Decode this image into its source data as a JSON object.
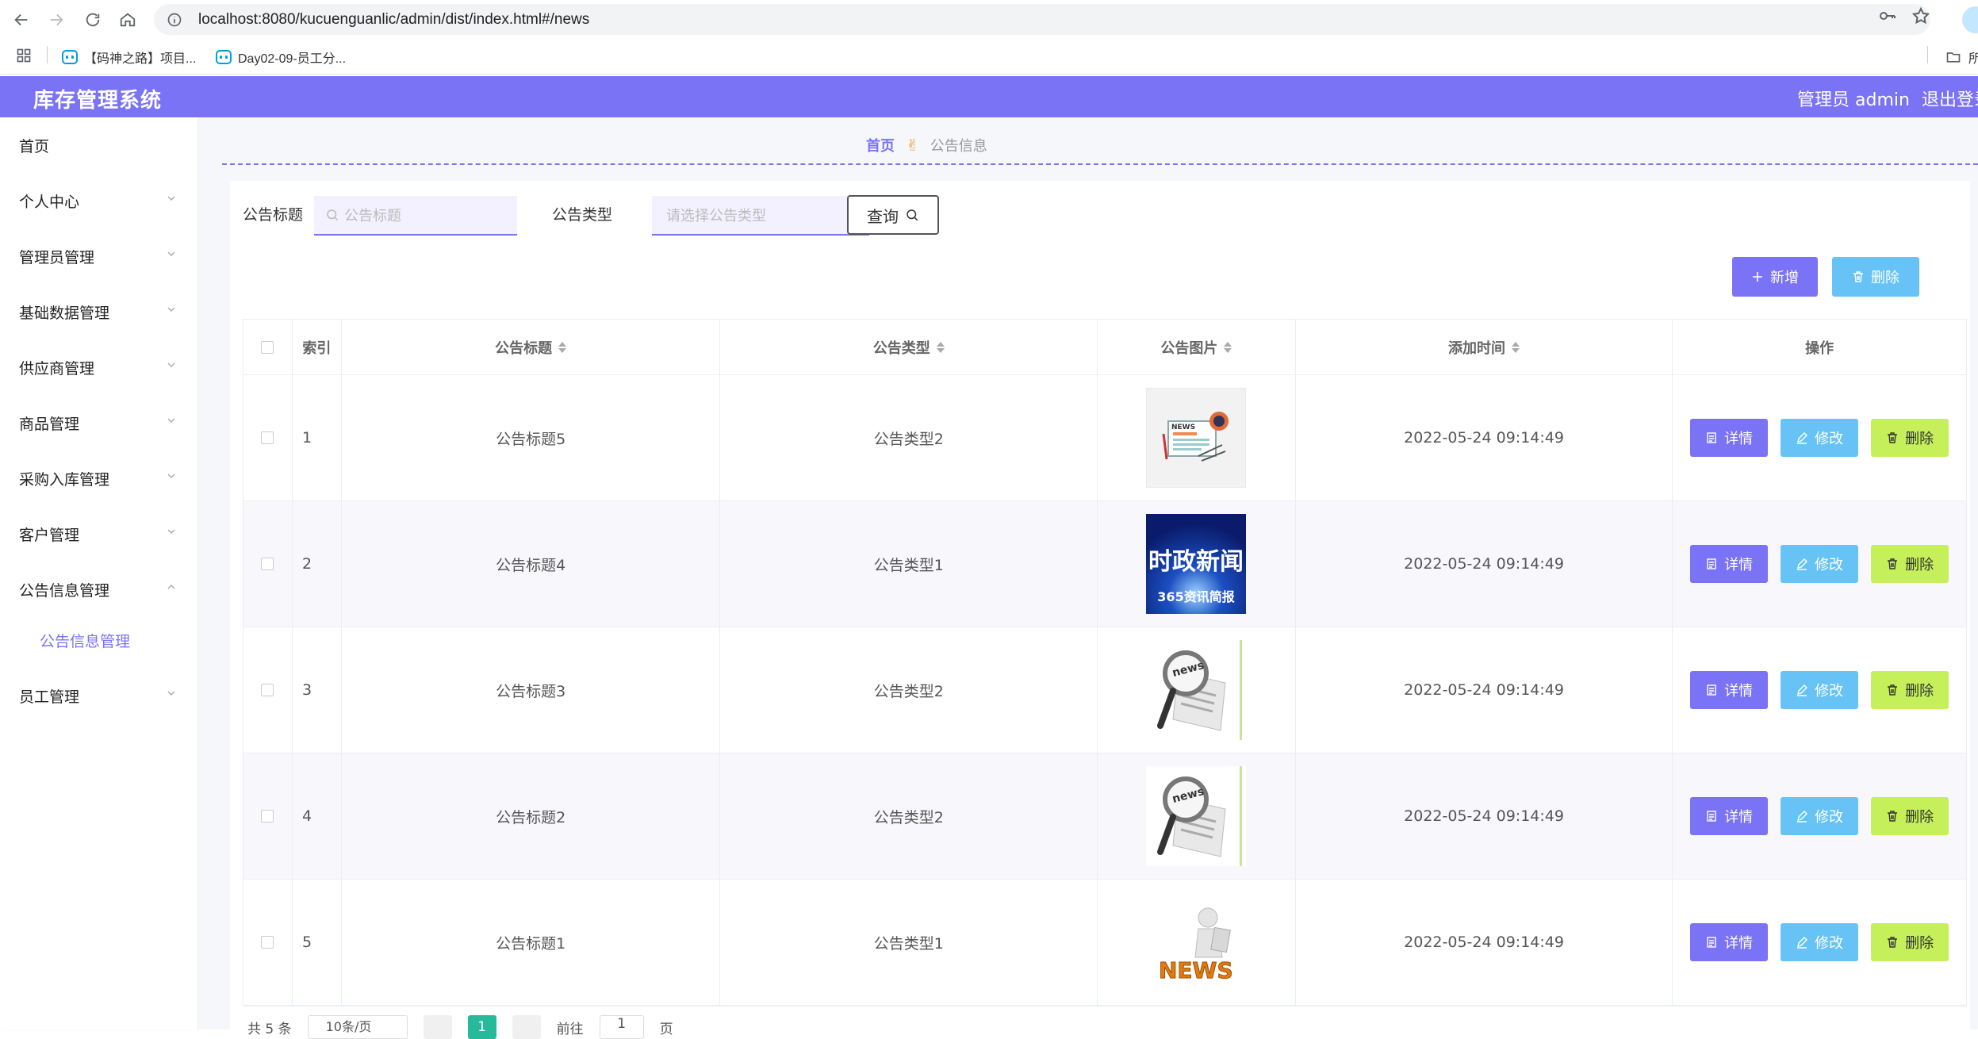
{
  "browser": {
    "url": "localhost:8080/kucuenguanlic/admin/dist/index.html#/news",
    "bookmarks": [
      {
        "label": "【码神之路】项目..."
      },
      {
        "label": "Day02-09-员工分..."
      }
    ],
    "bookmark_folder_label": "所"
  },
  "header": {
    "title": "库存管理系统",
    "user": "管理员 admin",
    "logout": "退出登录"
  },
  "sidebar": {
    "items": [
      {
        "label": "首页"
      },
      {
        "label": "个人中心"
      },
      {
        "label": "管理员管理"
      },
      {
        "label": "基础数据管理"
      },
      {
        "label": "供应商管理"
      },
      {
        "label": "商品管理"
      },
      {
        "label": "采购入库管理"
      },
      {
        "label": "客户管理"
      },
      {
        "label": "公告信息管理"
      },
      {
        "label": "员工管理"
      }
    ],
    "sub_item": "公告信息管理"
  },
  "breadcrumb": {
    "home": "首页",
    "current": "公告信息"
  },
  "search": {
    "title_label": "公告标题",
    "title_placeholder": "公告标题",
    "type_label": "公告类型",
    "type_placeholder": "请选择公告类型",
    "query_button": "查询"
  },
  "actions": {
    "add": "新增",
    "delete": "删除"
  },
  "table": {
    "columns": [
      "索引",
      "公告标题",
      "公告类型",
      "公告图片",
      "添加时间",
      "操作"
    ],
    "rows": [
      {
        "index": "1",
        "title": "公告标题5",
        "type": "公告类型2",
        "image": "news-paper",
        "time": "2022-05-24 09:14:49"
      },
      {
        "index": "2",
        "title": "公告标题4",
        "type": "公告类型1",
        "image": "politics-news",
        "time": "2022-05-24 09:14:49"
      },
      {
        "index": "3",
        "title": "公告标题3",
        "type": "公告类型2",
        "image": "magnifier-news",
        "time": "2022-05-24 09:14:49"
      },
      {
        "index": "4",
        "title": "公告标题2",
        "type": "公告类型2",
        "image": "magnifier-news",
        "time": "2022-05-24 09:14:49"
      },
      {
        "index": "5",
        "title": "公告标题1",
        "type": "公告类型1",
        "image": "figure-news",
        "time": "2022-05-24 09:14:49"
      }
    ],
    "row_buttons": {
      "detail": "详情",
      "edit": "修改",
      "delete": "删除"
    },
    "image_texts": {
      "news_word": "NEWS",
      "politics_main": "时政新闻",
      "politics_sub": "365资讯简报",
      "magnifier_word": "news"
    }
  },
  "pagination": {
    "total": "共 5 条",
    "page_size": "10条/页",
    "current": "1",
    "goto_label": "前往",
    "goto_value": "1",
    "page_unit": "页"
  },
  "colors": {
    "primary": "#7b73f6",
    "info": "#67c3f5",
    "success": "#c5f05a",
    "pager_active": "#26b99a"
  }
}
